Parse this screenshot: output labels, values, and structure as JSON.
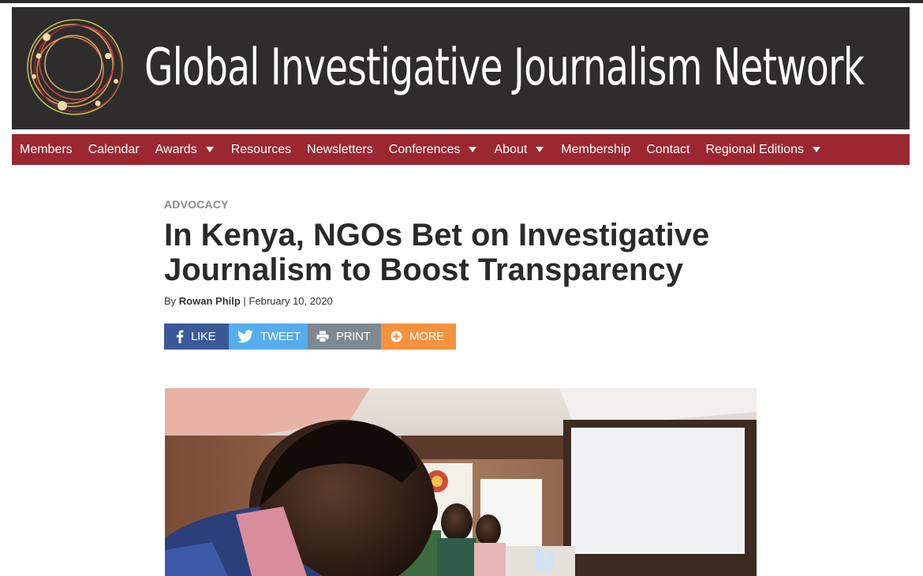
{
  "site": {
    "title": "Global Investigative Journalism Network"
  },
  "nav": {
    "items": [
      {
        "label": "Members"
      },
      {
        "label": "Calendar"
      },
      {
        "label": "Awards"
      },
      {
        "label": "Resources"
      },
      {
        "label": "Newsletters"
      },
      {
        "label": "Conferences"
      },
      {
        "label": "About"
      },
      {
        "label": "Membership"
      },
      {
        "label": "Contact"
      },
      {
        "label": "Regional Editions"
      }
    ]
  },
  "article": {
    "category": "ADVOCACY",
    "headline": "In Kenya, NGOs Bet on Investigative Journalism to Boost Transparency",
    "byline_prefix": "By",
    "author": "Rowan Philp",
    "separator": "|",
    "date": "February 10, 2020"
  },
  "share": {
    "like": "LIKE",
    "tweet": "TWEET",
    "print": "PRINT",
    "more": "MORE"
  },
  "colors": {
    "banner_bg": "#2e2d2c",
    "nav_bg": "#9b2730",
    "facebook": "#3b5998",
    "twitter": "#55acee",
    "print": "#7d8890",
    "more": "#f5923e"
  },
  "icons": {
    "logo": "orbit-rings-logo",
    "like": "facebook-icon",
    "tweet": "twitter-bird-icon",
    "print": "printer-icon",
    "more": "plus-circle-icon",
    "dropdown": "caret-down-icon"
  }
}
